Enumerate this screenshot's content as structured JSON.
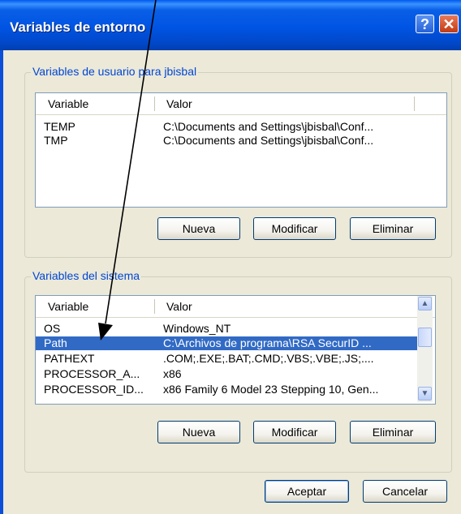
{
  "window": {
    "title": "Variables de entorno",
    "help_glyph": "?",
    "close_glyph": "✕"
  },
  "user_vars": {
    "group_label": "Variables de usuario para jbisbal",
    "columns": [
      "Variable",
      "Valor"
    ],
    "rows": [
      {
        "variable": "TEMP",
        "valor": "C:\\Documents and Settings\\jbisbal\\Conf..."
      },
      {
        "variable": "TMP",
        "valor": "C:\\Documents and Settings\\jbisbal\\Conf..."
      }
    ],
    "buttons": {
      "new": "Nueva",
      "edit": "Modificar",
      "delete": "Eliminar"
    }
  },
  "system_vars": {
    "group_label": "Variables del sistema",
    "columns": [
      "Variable",
      "Valor"
    ],
    "rows": [
      {
        "variable": "OS",
        "valor": "Windows_NT"
      },
      {
        "variable": "Path",
        "valor": "C:\\Archivos de programa\\RSA SecurID ...",
        "selected": true
      },
      {
        "variable": "PATHEXT",
        "valor": ".COM;.EXE;.BAT;.CMD;.VBS;.VBE;.JS;...."
      },
      {
        "variable": "PROCESSOR_A...",
        "valor": "x86"
      },
      {
        "variable": "PROCESSOR_ID...",
        "valor": "x86 Family 6 Model 23 Stepping 10, Gen..."
      }
    ],
    "buttons": {
      "new": "Nueva",
      "edit": "Modificar",
      "delete": "Eliminar"
    },
    "scroll_up_glyph": "▲",
    "scroll_down_glyph": "▼"
  },
  "footer": {
    "ok": "Aceptar",
    "cancel": "Cancelar"
  },
  "colors": {
    "titlebar": "#0054e3",
    "selection": "#316ac5",
    "group_label": "#0046d5",
    "annotation": "#000000"
  },
  "annotation": {
    "description_icon": "arrow-annotation"
  }
}
